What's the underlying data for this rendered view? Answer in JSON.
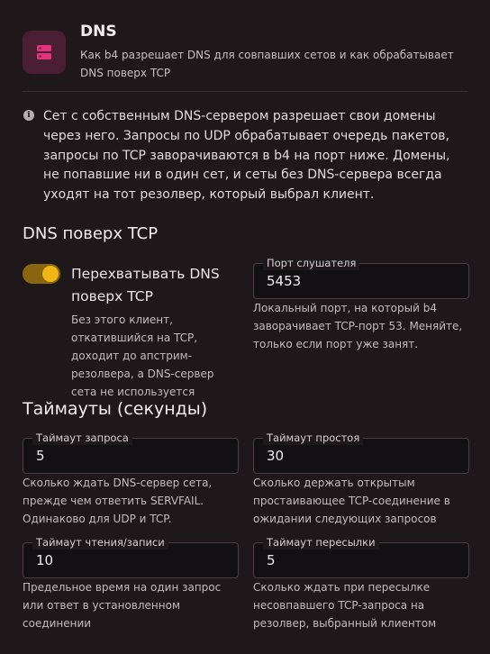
{
  "header": {
    "title": "DNS",
    "subtitle": "Как b4 разрешает DNS для совпавших сетов и как обрабатывает DNS поверх TCP",
    "icon": "server-icon"
  },
  "info": {
    "text": "Сет с собственным DNS-сервером разрешает свои домены через него. Запросы по UDP обрабатывает очередь пакетов, запросы по TCP заворачиваются в b4 на порт ниже. Домены, не попавшие ни в один сет, и сеты без DNS-сервера всегда уходят на тот резолвер, который выбрал клиент."
  },
  "dns_tcp": {
    "section_title": "DNS поверх TCP",
    "toggle": {
      "label": "Перехватывать DNS поверх TCP",
      "checked": true,
      "help": "Без этого клиент, откатившийся на TCP, доходит до апстрим-резолвера, а DNS-сервер сета не используется"
    },
    "listener_port": {
      "label": "Порт слушателя",
      "value": "5453",
      "help": "Локальный порт, на который b4 заворачивает TCP-порт 53. Меняйте, только если порт уже занят."
    }
  },
  "timeouts": {
    "section_title": "Таймауты (секунды)",
    "request": {
      "label": "Таймаут запроса",
      "value": "5",
      "help": "Сколько ждать DNS-сервер сета, прежде чем ответить SERVFAIL. Одинаково для UDP и TCP."
    },
    "idle": {
      "label": "Таймаут простоя",
      "value": "30",
      "help": "Сколько держать открытым простаивающее TCP-соединение в ожидании следующих запросов"
    },
    "read_write": {
      "label": "Таймаут чтения/записи",
      "value": "10",
      "help": "Предельное время на один запрос или ответ в установленном соединении"
    },
    "forward": {
      "label": "Таймаут пересылки",
      "value": "5",
      "help": "Сколько ждать при пересылке несовпавшего TCP-запроса на резолвер, выбранный клиентом"
    }
  },
  "colors": {
    "accent": "#f2b416",
    "icon_bg": "#4a1e33",
    "icon_fg": "#e0337a"
  }
}
